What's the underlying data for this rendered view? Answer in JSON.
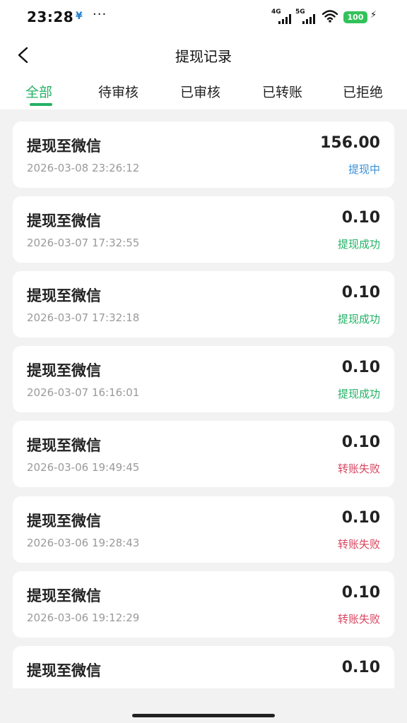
{
  "status_bar": {
    "time": "23:28",
    "app_icon": "¥",
    "more": "···",
    "network_1": "4G",
    "network_2": "5G",
    "battery": "100",
    "charge_icon": "⚡"
  },
  "header": {
    "title": "提现记录"
  },
  "tabs": [
    {
      "label": "全部",
      "active": true
    },
    {
      "label": "待审核",
      "active": false
    },
    {
      "label": "已审核",
      "active": false
    },
    {
      "label": "已转账",
      "active": false
    },
    {
      "label": "已拒绝",
      "active": false
    }
  ],
  "colors": {
    "accent": "#22b264",
    "status_processing": "#3a8fd6",
    "status_success": "#22b264",
    "status_failed": "#d9455f"
  },
  "records": [
    {
      "title": "提现至微信",
      "amount": "156.00",
      "time": "2026-03-08 23:26:12",
      "status": "提现中",
      "status_color": "#3a8fd6"
    },
    {
      "title": "提现至微信",
      "amount": "0.10",
      "time": "2026-03-07 17:32:55",
      "status": "提现成功",
      "status_color": "#22b264"
    },
    {
      "title": "提现至微信",
      "amount": "0.10",
      "time": "2026-03-07 17:32:18",
      "status": "提现成功",
      "status_color": "#22b264"
    },
    {
      "title": "提现至微信",
      "amount": "0.10",
      "time": "2026-03-07 16:16:01",
      "status": "提现成功",
      "status_color": "#22b264"
    },
    {
      "title": "提现至微信",
      "amount": "0.10",
      "time": "2026-03-06 19:49:45",
      "status": "转账失败",
      "status_color": "#d9455f"
    },
    {
      "title": "提现至微信",
      "amount": "0.10",
      "time": "2026-03-06 19:28:43",
      "status": "转账失败",
      "status_color": "#d9455f"
    },
    {
      "title": "提现至微信",
      "amount": "0.10",
      "time": "2026-03-06 19:12:29",
      "status": "转账失败",
      "status_color": "#d9455f"
    },
    {
      "title": "提现至微信",
      "amount": "0.10"
    }
  ]
}
